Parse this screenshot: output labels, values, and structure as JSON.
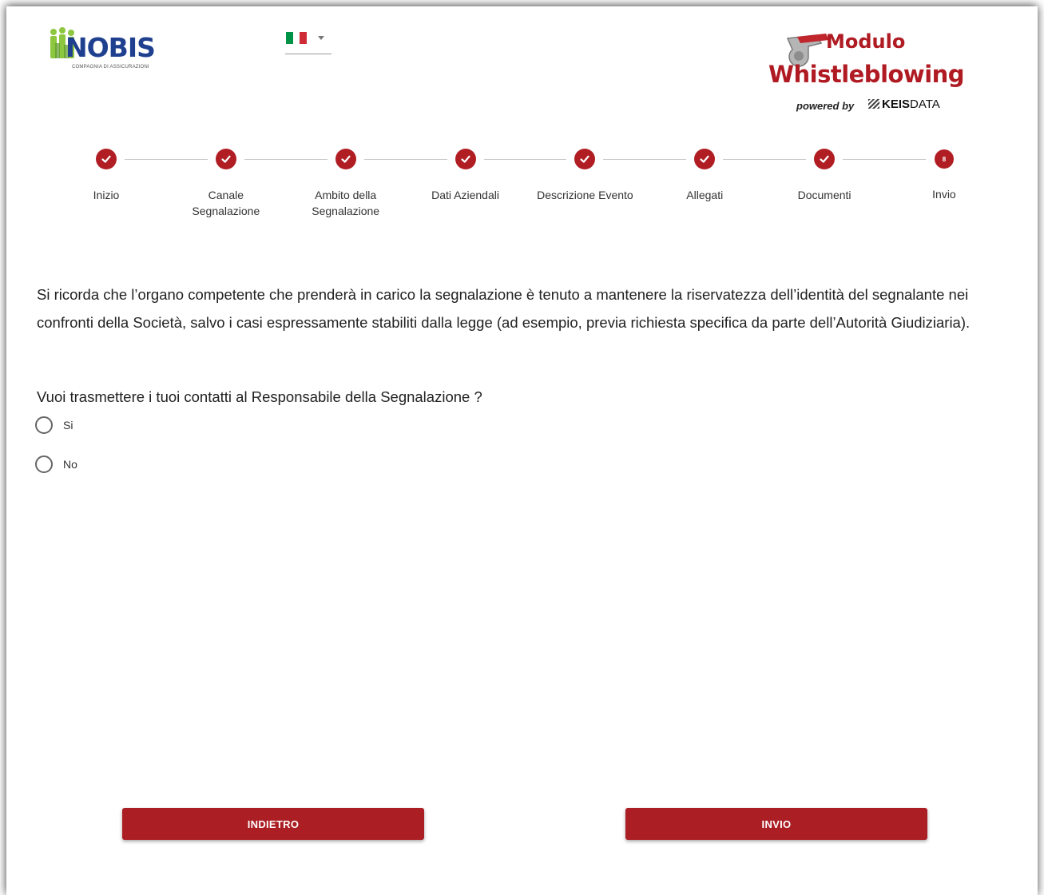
{
  "header": {
    "nobis_logo": {
      "wordmark": "NOBIS",
      "tagline": "COMPAGNIA DI ASSICURAZIONI"
    },
    "language": {
      "flag": "italy-flag",
      "flag_colors": [
        "#009246",
        "#ffffff",
        "#ce2b37"
      ]
    },
    "whistleblowing_logo": {
      "line1": "Modulo",
      "line2": "Whistleblowing",
      "powered_by": "powered by",
      "brand_bold": "KEIS",
      "brand_light": "DATA"
    }
  },
  "stepper": {
    "steps": [
      {
        "label": "Inizio",
        "status": "done"
      },
      {
        "label": "Canale Segnalazione",
        "status": "done"
      },
      {
        "label": "Ambito della Segnalazione",
        "status": "done"
      },
      {
        "label": "Dati Aziendali",
        "status": "done"
      },
      {
        "label": "Descrizione Evento",
        "status": "done"
      },
      {
        "label": "Allegati",
        "status": "done"
      },
      {
        "label": "Documenti",
        "status": "done"
      },
      {
        "label": "Invio",
        "status": "current",
        "number": "8"
      }
    ]
  },
  "content": {
    "notice": "Si ricorda che l’organo competente che prenderà in carico la segnalazione è tenuto a mantenere la riservatezza dell’identità del segnalante nei confronti della Società, salvo i casi espressamente stabiliti dalla legge (ad esempio, previa richiesta specifica da parte dell’Autorità Giudiziaria).",
    "question": "Vuoi trasmettere i tuoi contatti al Responsabile della Segnalazione ?",
    "options": [
      {
        "label": "Si",
        "selected": false
      },
      {
        "label": "No",
        "selected": false
      }
    ]
  },
  "actions": {
    "back_label": "INDIETRO",
    "submit_label": "INVIO"
  },
  "colors": {
    "accent": "#ab1e24",
    "logo_blue": "#1f3f8f",
    "logo_green": "#8dc63f"
  }
}
